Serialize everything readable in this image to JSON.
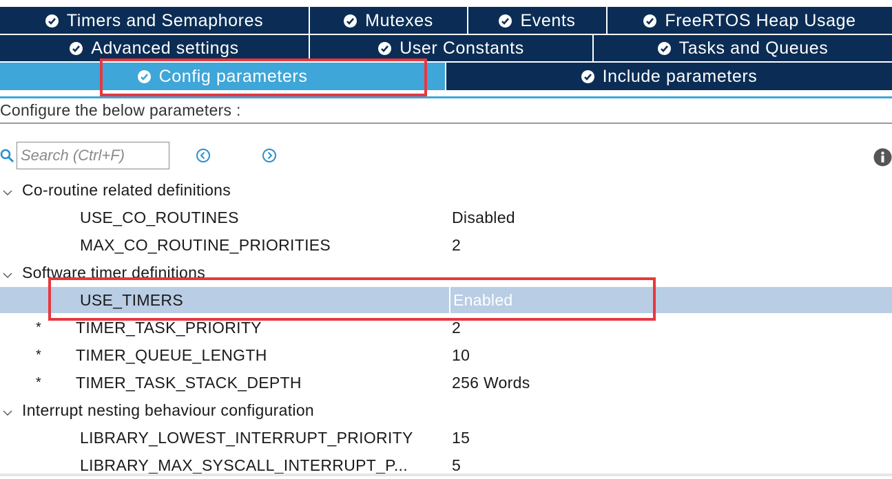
{
  "tabs": {
    "row1": [
      {
        "label": "Timers and Semaphores"
      },
      {
        "label": "Mutexes"
      },
      {
        "label": "Events"
      },
      {
        "label": "FreeRTOS Heap Usage"
      }
    ],
    "row2": [
      {
        "label": "Advanced settings"
      },
      {
        "label": "User Constants"
      },
      {
        "label": "Tasks and Queues"
      }
    ],
    "row3": [
      {
        "label": "Config parameters",
        "active": true
      },
      {
        "label": "Include parameters"
      }
    ]
  },
  "configure_label": "Configure the below parameters :",
  "search": {
    "placeholder": "Search (Ctrl+F)"
  },
  "groups": [
    {
      "label": "Co-routine related definitions",
      "params": [
        {
          "name": "USE_CO_ROUTINES",
          "value": "Disabled"
        },
        {
          "name": "MAX_CO_ROUTINE_PRIORITIES",
          "value": "2"
        }
      ]
    },
    {
      "label": "Software timer definitions",
      "params": [
        {
          "name": "USE_TIMERS",
          "value": "Enabled",
          "selected": true
        },
        {
          "name": "TIMER_TASK_PRIORITY",
          "value": "2",
          "star": "*"
        },
        {
          "name": "TIMER_QUEUE_LENGTH",
          "value": "10",
          "star": "*"
        },
        {
          "name": "TIMER_TASK_STACK_DEPTH",
          "value": "256 Words",
          "star": "*"
        }
      ]
    },
    {
      "label": "Interrupt nesting behaviour configuration",
      "params": [
        {
          "name": "LIBRARY_LOWEST_INTERRUPT_PRIORITY",
          "value": "15"
        },
        {
          "name": "LIBRARY_MAX_SYSCALL_INTERRUPT_P...",
          "value": "5"
        }
      ]
    }
  ],
  "colors": {
    "tab_bg": "#0b2d55",
    "tab_active_bg": "#3ea6d8",
    "selected_row_bg": "#b9cde4",
    "highlight_red": "#e8373e"
  }
}
